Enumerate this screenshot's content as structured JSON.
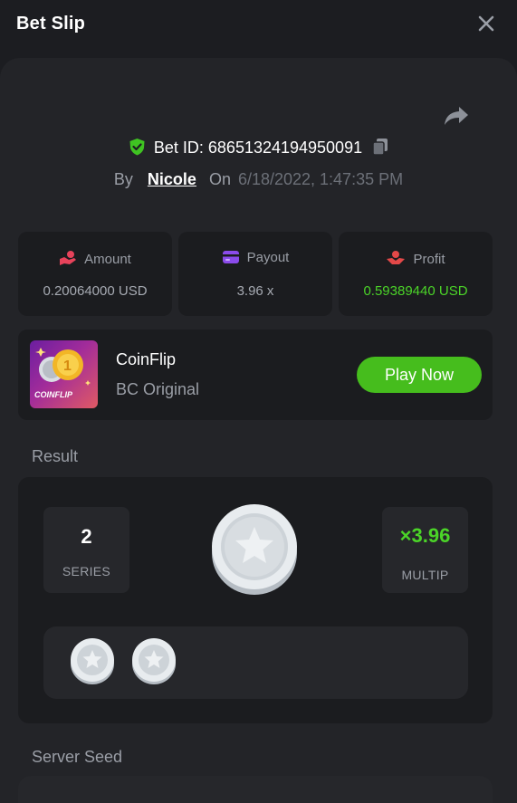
{
  "header": {
    "title": "Bet Slip"
  },
  "bet": {
    "id_label": "Bet ID: 68651324194950091",
    "by_label": "By",
    "user": "Nicole",
    "on_label": "On",
    "date": "6/18/2022, 1:47:35 PM"
  },
  "stats": [
    {
      "label": "Amount",
      "value": "0.20064000 USD",
      "icon": "hand-coins-icon",
      "icon_color": "#e8435b"
    },
    {
      "label": "Payout",
      "value": "3.96 x",
      "icon": "card-icon",
      "icon_color": "#8b4bea"
    },
    {
      "label": "Profit",
      "value": "0.59389440 USD",
      "icon": "hand-profit-icon",
      "icon_color": "#e34848"
    }
  ],
  "game": {
    "thumb_text": "COINFLIP",
    "name": "CoinFlip",
    "subtitle": "BC Original",
    "play_label": "Play Now"
  },
  "result": {
    "section_label": "Result",
    "series_value": "2",
    "series_label": "SERIES",
    "multiplier_value": "×3.96",
    "multiplier_label": "MULTIP",
    "history_count": 2
  },
  "server_seed": {
    "section_label": "Server Seed"
  },
  "colors": {
    "accent_green": "#46bd1d",
    "profit_green": "#4bd428",
    "panel": "#1b1c1f",
    "background": "#232428"
  }
}
